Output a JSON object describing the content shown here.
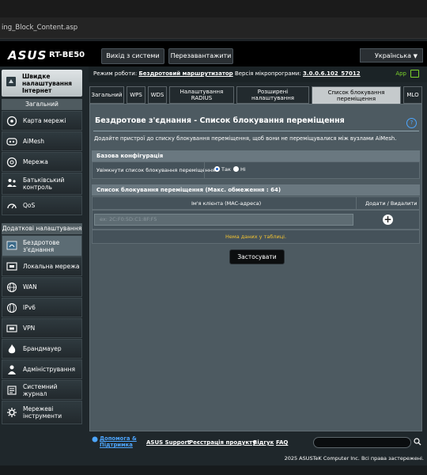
{
  "browser": {
    "url_fragment": "ing_Block_Content.asp"
  },
  "header": {
    "brand": "ASUS",
    "model": "RT-BE50",
    "logout_label": "Вихід з системи",
    "reboot_label": "Перезавантажити",
    "language": "Українська"
  },
  "status": {
    "mode_label": "Режим роботи:",
    "mode_value": "Бездротовий маршрутизатор",
    "firmware_label": "Версія мікропрограми:",
    "firmware_value": "3.0.0.6.102_57012",
    "app_label": "App"
  },
  "sidebar": {
    "quick_setup": "Швидке налаштування Інтернет",
    "general_header": "Загальний",
    "general_items": [
      {
        "label": "Карта мережі",
        "icon": "network-map-icon"
      },
      {
        "label": "AiMesh",
        "icon": "aimesh-icon"
      },
      {
        "label": "Мережа",
        "icon": "network-icon"
      },
      {
        "label": "Батьківський контроль",
        "icon": "parental-control-icon"
      },
      {
        "label": "QoS",
        "icon": "qos-icon"
      }
    ],
    "advanced_header": "Додаткові налаштування",
    "advanced_items": [
      {
        "label": "Бездротове з'єднання",
        "icon": "wireless-icon",
        "active": true
      },
      {
        "label": "Локальна мережа",
        "icon": "lan-icon"
      },
      {
        "label": "WAN",
        "icon": "wan-icon"
      },
      {
        "label": "IPv6",
        "icon": "ipv6-icon"
      },
      {
        "label": "VPN",
        "icon": "vpn-icon"
      },
      {
        "label": "Брандмауер",
        "icon": "firewall-icon"
      },
      {
        "label": "Адміністрування",
        "icon": "administration-icon"
      },
      {
        "label": "Системний журнал",
        "icon": "system-log-icon"
      },
      {
        "label": "Мережеві інструменти",
        "icon": "network-tools-icon"
      }
    ]
  },
  "tabs": [
    {
      "label": "Загальний"
    },
    {
      "label": "WPS"
    },
    {
      "label": "WDS"
    },
    {
      "label": "Налаштування RADIUS"
    },
    {
      "label": "Розширені налаштування"
    },
    {
      "label": "Список блокування переміщення",
      "active": true
    },
    {
      "label": "MLO"
    }
  ],
  "page": {
    "title": "Бездротове з'єднання - Список блокування переміщення",
    "description": "Додайте пристрої до списку блокування переміщення, щоб вони не переміщувалися між вузлами AiMesh.",
    "basic_config_header": "Базова конфігурація",
    "enable_label": "Увімкнути список блокування переміщення",
    "option_yes": "Так",
    "option_no": "Ні",
    "enabled": "Так",
    "list_header": "Список блокування переміщення (Макс. обмеження : 64)",
    "col_client": "Ім'я клієнта (MAC-адреса)",
    "col_add_delete": "Додати / Видалити",
    "mac_placeholder": "ex: 2C:F0:5D:C1:8F:F5",
    "no_data": "Нема даних у таблиці.",
    "apply_label": "Застосувати"
  },
  "footer": {
    "help_label": "Допомога & Підтримка",
    "links": [
      "ASUS Support",
      "Реєстрація продукту",
      "Відгук",
      "FAQ"
    ],
    "copyright": "2025 ASUSTeK Computer Inc. Всі права застережені."
  }
}
